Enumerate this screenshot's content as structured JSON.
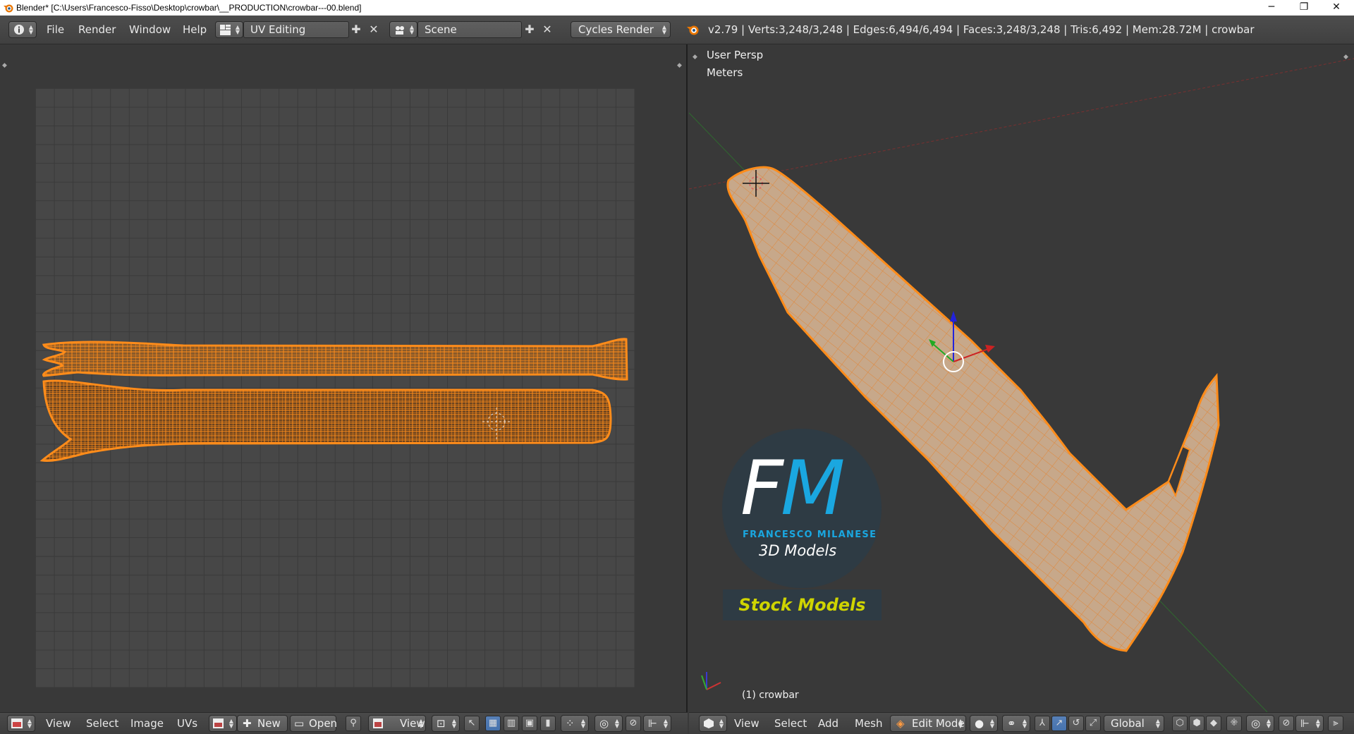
{
  "window": {
    "title": "Blender* [C:\\Users\\Francesco-Fisso\\Desktop\\crowbar\\__PRODUCTION\\crowbar---00.blend]",
    "minimize": "─",
    "restore": "❐",
    "close": "✕"
  },
  "info_header": {
    "menus": [
      "File",
      "Render",
      "Window",
      "Help"
    ],
    "screen_layout": "UV Editing",
    "scene": "Scene",
    "render_engine": "Cycles Render",
    "stats": "v2.79 | Verts:3,248/3,248 | Edges:6,494/6,494 | Faces:3,248/3,248 | Tris:6,492 | Mem:28.72M | crowbar"
  },
  "viewport": {
    "view_name": "User Persp",
    "units": "Meters",
    "object_label": "(1) crowbar"
  },
  "watermark": {
    "logo_f": "F",
    "logo_m": "M",
    "name": "FRANCESCO MILANESE",
    "subtitle": "3D Models",
    "badge": "Stock Models"
  },
  "uv_footer": {
    "menus": [
      "View",
      "Select",
      "Image",
      "UVs"
    ],
    "new_label": "New",
    "open_label": "Open",
    "view_label": "View"
  },
  "viewport_footer": {
    "menus": [
      "View",
      "Select",
      "Add",
      "Mesh"
    ],
    "mode": "Edit Mode",
    "orientation": "Global"
  },
  "colors": {
    "accent_orange": "#ff8c1a",
    "active_blue": "#5680c2",
    "logo_blue": "#1aa7e0",
    "badge_text": "#cfd400"
  }
}
